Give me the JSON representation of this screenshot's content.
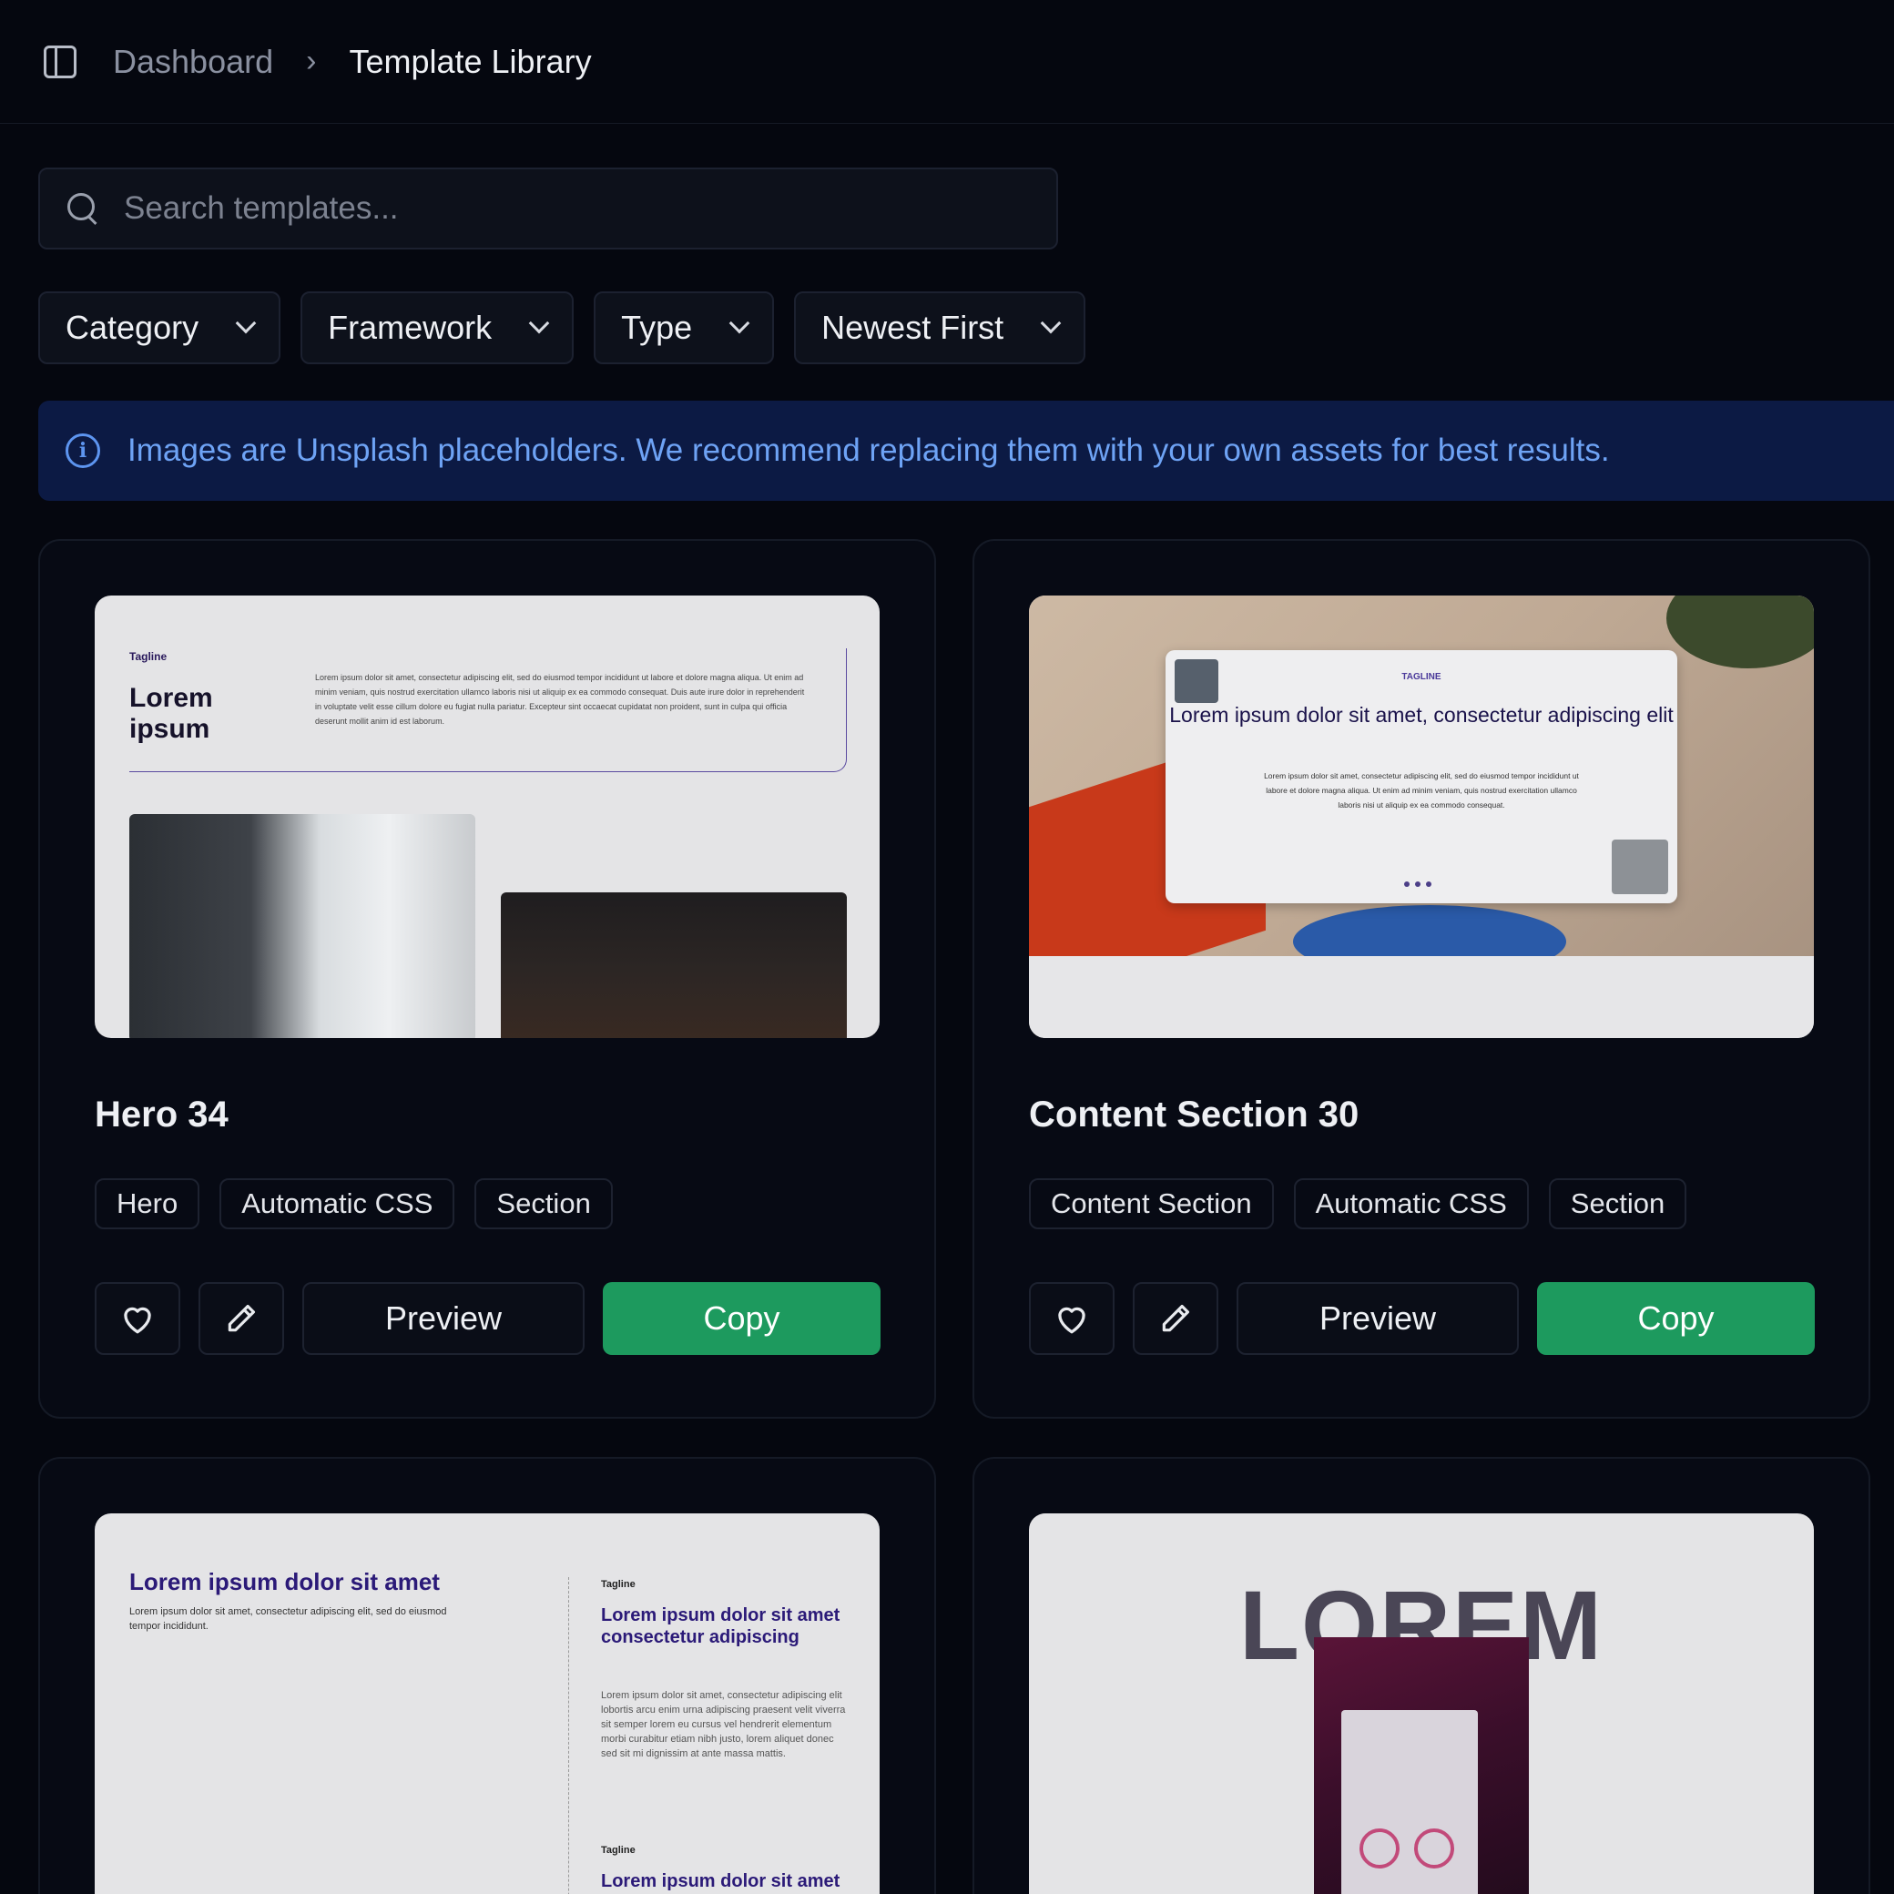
{
  "breadcrumb": {
    "parent": "Dashboard",
    "separator": "›",
    "current": "Template Library"
  },
  "search": {
    "placeholder": "Search templates...",
    "value": ""
  },
  "filters": [
    {
      "label": "Category"
    },
    {
      "label": "Framework"
    },
    {
      "label": "Type"
    },
    {
      "label": "Newest First"
    }
  ],
  "banner": {
    "text": "Images are Unsplash placeholders. We recommend replacing them with your own assets for best results."
  },
  "cards": [
    {
      "title": "Hero 34",
      "tags": [
        "Hero",
        "Automatic CSS",
        "Section"
      ],
      "preview_label": "Preview",
      "copy_label": "Copy",
      "thumb": {
        "tagline": "Tagline",
        "heading": "Lorem ipsum",
        "body": "Lorem ipsum dolor sit amet, consectetur adipiscing elit, sed do eiusmod tempor incididunt ut labore et dolore magna aliqua. Ut enim ad minim veniam, quis nostrud exercitation ullamco laboris nisi ut aliquip ex ea commodo consequat. Duis aute irure dolor in reprehenderit in voluptate velit esse cillum dolore eu fugiat nulla pariatur. Excepteur sint occaecat cupidatat non proident, sunt in culpa qui officia deserunt mollit anim id est laborum."
      }
    },
    {
      "title": "Content Section 30",
      "tags": [
        "Content Section",
        "Automatic CSS",
        "Section"
      ],
      "preview_label": "Preview",
      "copy_label": "Copy",
      "thumb": {
        "tagline": "TAGLINE",
        "heading": "Lorem ipsum dolor sit amet, consectetur adipiscing elit",
        "body": "Lorem ipsum dolor sit amet, consectetur adipiscing elit, sed do eiusmod tempor incididunt ut labore et dolore magna aliqua. Ut enim ad minim veniam, quis nostrud exercitation ullamco laboris nisi ut aliquip ex ea commodo consequat."
      }
    },
    {
      "thumb": {
        "heading": "Lorem ipsum dolor sit amet",
        "sub": "Lorem ipsum dolor sit amet, consectetur adipiscing elit, sed do eiusmod tempor incididunt.",
        "tagline": "Tagline",
        "heading2": "Lorem ipsum dolor sit amet consectetur adipiscing",
        "body": "Lorem ipsum dolor sit amet, consectetur adipiscing elit lobortis arcu enim urna adipiscing praesent velit viverra sit semper lorem eu cursus vel hendrerit elementum morbi curabitur etiam nibh justo, lorem aliquet donec sed sit mi dignissim at ante massa mattis.",
        "tagline2": "Tagline",
        "heading3": "Lorem ipsum dolor sit amet consectetur"
      }
    },
    {
      "thumb": {
        "word": "LOREM"
      }
    }
  ],
  "colors": {
    "accent_copy": "#1d9a5e",
    "banner_bg": "#0c1a44",
    "banner_text": "#6ea3f5"
  }
}
